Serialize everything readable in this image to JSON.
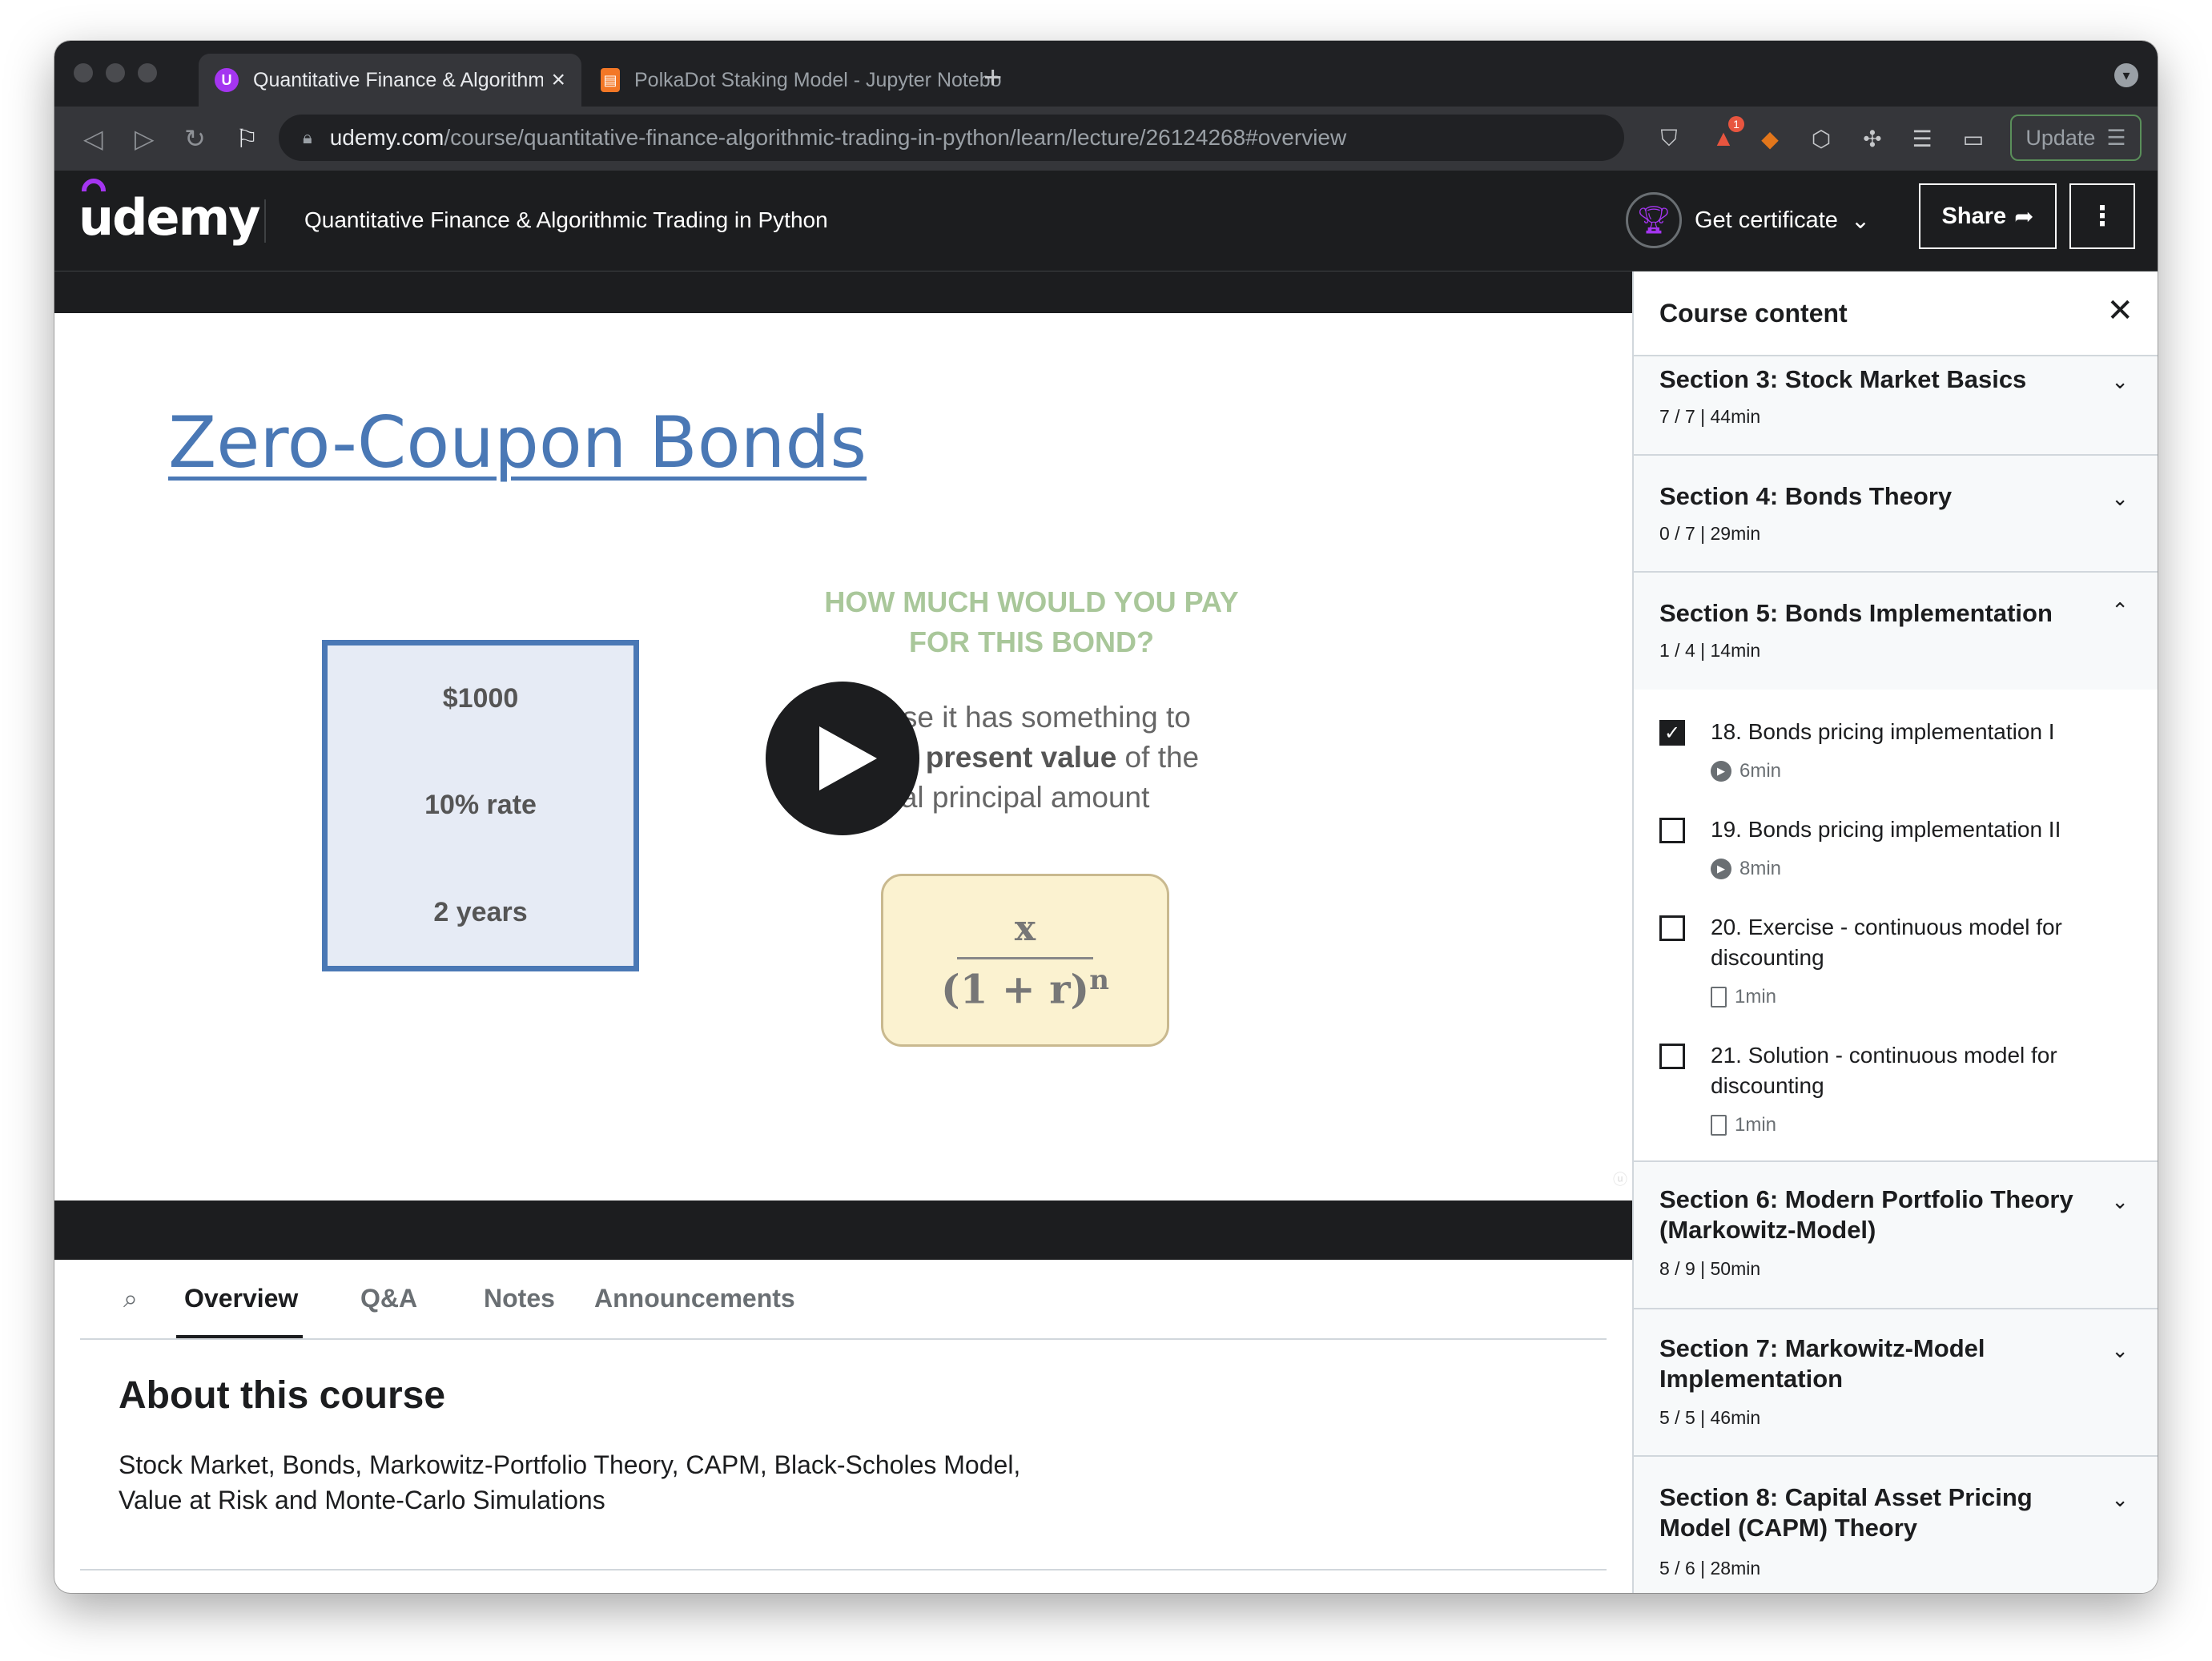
{
  "browser": {
    "tabs": [
      {
        "title": "Quantitative Finance & Algorithmic Trading in Python",
        "favicon": "udemy-icon",
        "active": true
      },
      {
        "title": "PolkaDot Staking Model - Jupyter Notebook",
        "favicon": "jupyter-icon",
        "active": false
      }
    ],
    "url_host": "udemy.com",
    "url_path": "/course/quantitative-finance-algorithmic-trading-in-python/learn/lecture/26124268#overview",
    "update_label": "Update",
    "notification_count": "1"
  },
  "header": {
    "logo": "udemy",
    "course_title": "Quantitative Finance & Algorithmic Trading in Python",
    "certificate_label": "Get certificate",
    "share_label": "Share"
  },
  "slide": {
    "title": "Zero-Coupon Bonds",
    "box": [
      "$1000",
      "10% rate",
      "2 years"
    ],
    "question": "HOW MUCH WOULD YOU PAY FOR THIS BOND?",
    "explain_1": "urse it has something to",
    "explain_2a": " the ",
    "explain_2b": "present value",
    "explain_2c": " of the",
    "explain_3": "tual principal amount",
    "formula_num": "x",
    "formula_den": "(1 + r)",
    "formula_exp": "n"
  },
  "tabs": [
    "Overview",
    "Q&A",
    "Notes",
    "Announcements"
  ],
  "about": {
    "heading": "About this course",
    "description": "Stock Market, Bonds, Markowitz-Portfolio Theory, CAPM, Black-Scholes Model, Value at Risk and Monte-Carlo Simulations"
  },
  "sidebar": {
    "title": "Course content",
    "sections": [
      {
        "title": "Section 3: Stock Market Basics",
        "stats": "7 / 7 | 44min",
        "expanded": false
      },
      {
        "title": "Section 4: Bonds Theory",
        "stats": "0 / 7 | 29min",
        "expanded": false
      },
      {
        "title": "Section 5: Bonds Implementation",
        "stats": "1 / 4 | 14min",
        "expanded": true
      },
      {
        "title": "Section 6: Modern Portfolio Theory (Markowitz-Model)",
        "stats": "8 / 9 | 50min",
        "expanded": false
      },
      {
        "title": "Section 7: Markowitz-Model Implementation",
        "stats": "5 / 5 | 46min",
        "expanded": false
      },
      {
        "title": "Section 8: Capital Asset Pricing Model (CAPM) Theory",
        "stats": "5 / 6 | 28min",
        "expanded": false
      }
    ],
    "lectures": [
      {
        "title": "18. Bonds pricing implementation I",
        "duration": "6min",
        "type": "video",
        "done": true
      },
      {
        "title": "19. Bonds pricing implementation II",
        "duration": "8min",
        "type": "video",
        "done": false
      },
      {
        "title": "20. Exercise - continuous model for discounting",
        "duration": "1min",
        "type": "file",
        "done": false
      },
      {
        "title": "21. Solution - continuous model for discounting",
        "duration": "1min",
        "type": "file",
        "done": false
      }
    ]
  }
}
